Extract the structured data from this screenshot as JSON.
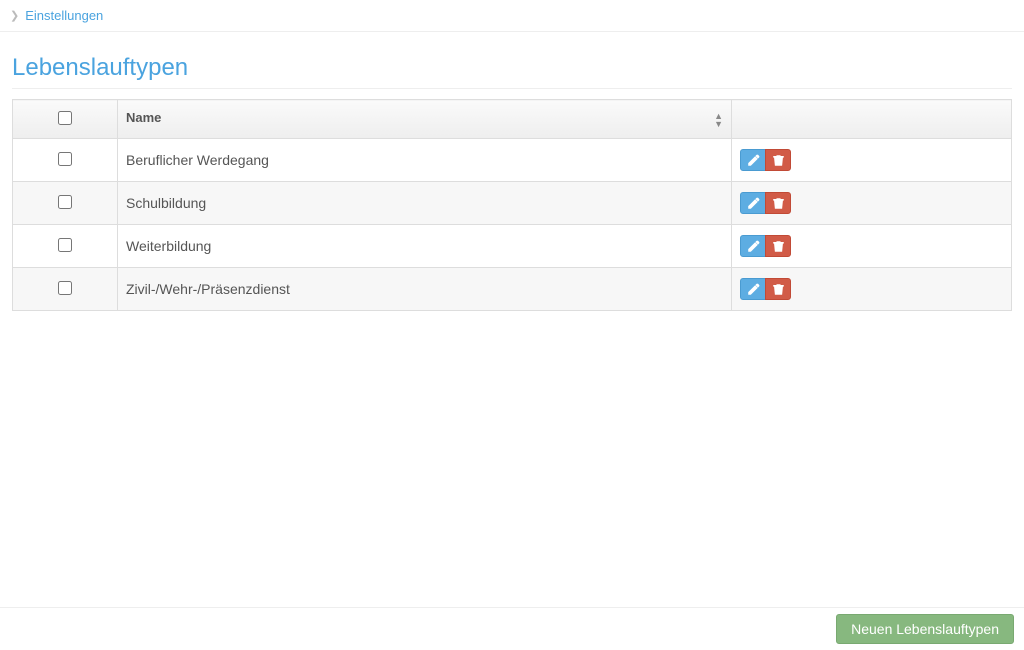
{
  "breadcrumb": {
    "items": [
      "Einstellungen"
    ]
  },
  "page": {
    "title": "Lebenslauftypen"
  },
  "table": {
    "columns": {
      "name": "Name"
    },
    "rows": [
      {
        "name": "Beruflicher Werdegang"
      },
      {
        "name": "Schulbildung"
      },
      {
        "name": "Weiterbildung"
      },
      {
        "name": "Zivil-/Wehr-/Präsenzdienst"
      }
    ]
  },
  "actions": {
    "new": "Neuen Lebenslauftypen"
  }
}
